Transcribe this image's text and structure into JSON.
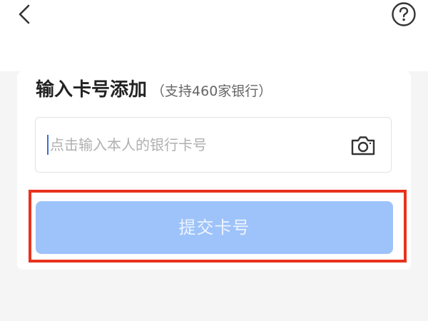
{
  "header": {
    "back_icon": "chevron-left-icon",
    "help_icon": "question-circle-icon"
  },
  "card": {
    "title": "输入卡号添加",
    "subtitle": "（支持460家银行）"
  },
  "card_input": {
    "placeholder": "点击输入本人的银行卡号",
    "value": "",
    "camera_icon": "camera-icon"
  },
  "submit": {
    "label": "提交卡号"
  },
  "colors": {
    "highlight": "#e8321e",
    "button": "#9ec3fa",
    "cursor": "#3a6fd8"
  }
}
